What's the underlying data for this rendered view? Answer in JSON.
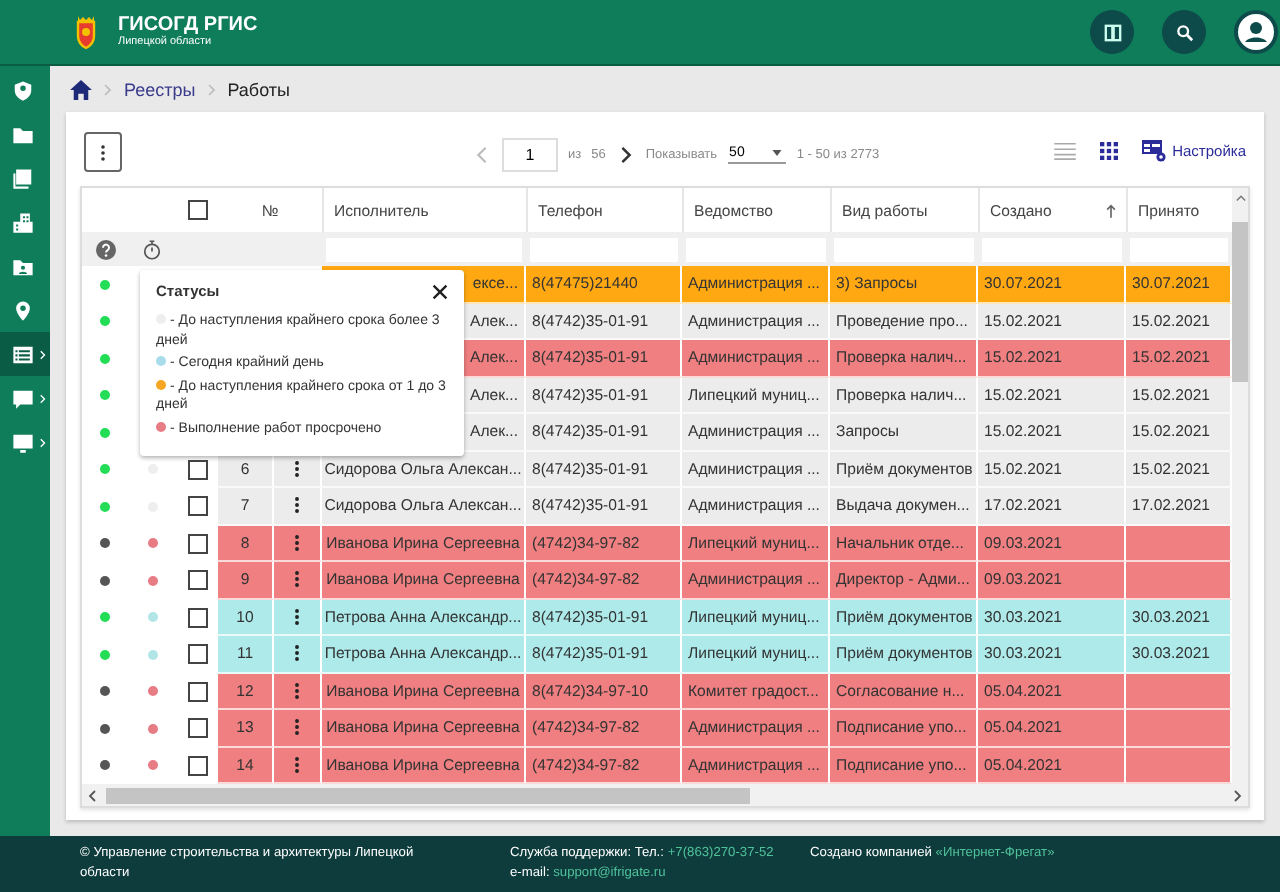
{
  "header": {
    "title": "ГИСОГД РГИС",
    "subtitle": "Липецкой области"
  },
  "sidebar": {
    "items": [
      {
        "kind": "account",
        "selected": false,
        "expandable": false
      },
      {
        "kind": "folder",
        "selected": false,
        "expandable": false
      },
      {
        "kind": "documents",
        "selected": false,
        "expandable": false
      },
      {
        "kind": "buildings",
        "selected": false,
        "expandable": false
      },
      {
        "kind": "folder-person",
        "selected": false,
        "expandable": false
      },
      {
        "kind": "pin",
        "selected": false,
        "expandable": false
      },
      {
        "kind": "list",
        "selected": true,
        "expandable": true
      },
      {
        "kind": "help-chat",
        "selected": false,
        "expandable": true
      },
      {
        "kind": "monitor",
        "selected": false,
        "expandable": true
      }
    ]
  },
  "breadcrumbs": [
    "Реестры",
    "Работы"
  ],
  "toolbar": {
    "page": "1",
    "of_label": "из",
    "page_count": "56",
    "show_label": "Показывать",
    "page_size": "50",
    "range": "1 - 50 из 2773",
    "settings_label": "Настройка"
  },
  "table": {
    "select_all": {
      "checked": false
    },
    "columns": [
      "№",
      "Исполнитель",
      "Телефон",
      "Ведомство",
      "Вид работы",
      "Создано",
      "Принято"
    ],
    "rows": [
      {
        "status": {
          "color": "#22dd55"
        },
        "color": "#ffa812",
        "executor": "ексе...",
        "phone": "8(47475)21440",
        "department": "Администрация ...",
        "work_type": "3) Запросы",
        "created": "30.07.2021",
        "accepted": "30.07.2021"
      },
      {
        "status": {
          "color": "#22dd55"
        },
        "color": "#ececec",
        "executor": "Алек...",
        "phone": "8(4742)35-01-91",
        "department": "Администрация ...",
        "work_type": "Проведение про...",
        "created": "15.02.2021",
        "accepted": "15.02.2021"
      },
      {
        "status": {
          "color": "#22dd55"
        },
        "color": "#ef7f80",
        "executor": "Алек...",
        "phone": "8(4742)35-01-91",
        "department": "Администрация ...",
        "work_type": "Проверка налич...",
        "created": "15.02.2021",
        "accepted": "15.02.2021"
      },
      {
        "status": {
          "color": "#22dd55"
        },
        "color": "#ececec",
        "executor": "Алек...",
        "phone": "8(4742)35-01-91",
        "department": "Липецкий муниц...",
        "work_type": "Проверка налич...",
        "created": "15.02.2021",
        "accepted": "15.02.2021"
      },
      {
        "status": {
          "color": "#22dd55"
        },
        "color": "#ececec",
        "executor": "Алек...",
        "phone": "8(4742)35-01-91",
        "department": "Администрация ...",
        "work_type": "Запросы",
        "created": "15.02.2021",
        "accepted": "15.02.2021"
      },
      {
        "status": {
          "color": "#22dd55"
        },
        "deadline": {
          "color": "#eeeeee"
        },
        "checked": false,
        "no": "6",
        "color": "#ececec",
        "executor": "Сидорова Ольга Алексан...",
        "phone": "8(4742)35-01-91",
        "department": "Администрация ...",
        "work_type": "Приём документов",
        "created": "15.02.2021",
        "accepted": "15.02.2021"
      },
      {
        "status": {
          "color": "#22dd55"
        },
        "deadline": {
          "color": "#eeeeee"
        },
        "checked": false,
        "no": "7",
        "color": "#ececec",
        "executor": "Сидорова Ольга Алексан...",
        "phone": "8(4742)35-01-91",
        "department": "Администрация ...",
        "work_type": "Выдача докумен...",
        "created": "17.02.2021",
        "accepted": "17.02.2021"
      },
      {
        "status": {
          "color": "#555555"
        },
        "deadline": {
          "color": "#e87c84"
        },
        "checked": false,
        "no": "8",
        "color": "#ef7f80",
        "executor": "Иванова Ирина Сергеевна",
        "phone": "(4742)34-97-82",
        "department": "Липецкий муниц...",
        "work_type": "Начальник отде...",
        "created": "09.03.2021"
      },
      {
        "status": {
          "color": "#555555"
        },
        "deadline": {
          "color": "#e87c84"
        },
        "checked": false,
        "no": "9",
        "color": "#ef7f80",
        "executor": "Иванова Ирина Сергеевна",
        "phone": "(4742)34-97-82",
        "department": "Администрация ...",
        "work_type": "Директор - Адми...",
        "created": "09.03.2021"
      },
      {
        "status": {
          "color": "#22dd55"
        },
        "deadline": {
          "color": "#b2e6e6"
        },
        "checked": false,
        "no": "10",
        "color": "#aeeaea",
        "executor": "Петрова Анна Александр...",
        "phone": "8(4742)35-01-91",
        "department": "Липецкий муниц...",
        "work_type": "Приём документов",
        "created": "30.03.2021",
        "accepted": "30.03.2021"
      },
      {
        "status": {
          "color": "#22dd55"
        },
        "deadline": {
          "color": "#b2e6e6"
        },
        "checked": false,
        "no": "11",
        "color": "#aeeaea",
        "executor": "Петрова Анна Александр...",
        "phone": "8(4742)35-01-91",
        "department": "Липецкий муниц...",
        "work_type": "Приём документов",
        "created": "30.03.2021",
        "accepted": "30.03.2021"
      },
      {
        "status": {
          "color": "#555555"
        },
        "deadline": {
          "color": "#e87c84"
        },
        "checked": false,
        "no": "12",
        "color": "#ef7f80",
        "executor": "Иванова Ирина Сергеевна",
        "phone": "8(4742)34-97-10",
        "department": "Комитет градост...",
        "work_type": "Согласование н...",
        "created": "05.04.2021"
      },
      {
        "status": {
          "color": "#555555"
        },
        "deadline": {
          "color": "#e87c84"
        },
        "checked": false,
        "no": "13",
        "color": "#ef7f80",
        "executor": "Иванова Ирина Сергеевна",
        "phone": "(4742)34-97-82",
        "department": "Администрация ...",
        "work_type": "Подписание упо...",
        "created": "05.04.2021"
      },
      {
        "status": {
          "color": "#555555"
        },
        "deadline": {
          "color": "#e87c84"
        },
        "checked": false,
        "no": "14",
        "color": "#ef7f80",
        "executor": "Иванова Ирина Сергеевна",
        "phone": "(4742)34-97-82",
        "department": "Администрация ...",
        "work_type": "Подписание упо...",
        "created": "05.04.2021"
      }
    ]
  },
  "legend": {
    "title": "Статусы",
    "items": [
      {
        "color": "#eeeeee",
        "text": "- До наступления крайнего срока более 3 дней"
      },
      {
        "color": "#a8dcea",
        "text": "- Сегодня крайний день"
      },
      {
        "color": "#f5a623",
        "text": "- До наступления крайнего срока от 1 до 3 дней"
      },
      {
        "color": "#e87c84",
        "text": "- Выполнение работ просрочено"
      }
    ]
  },
  "footer": {
    "copyright": "© Управление строительства и архитектуры Липецкой области",
    "support_label": "Служба поддержки: Тел.:",
    "phone": "+7(863)270-37-52",
    "email_label": "e-mail:",
    "email": "support@ifrigate.ru",
    "credit_label": "Создано компанией",
    "credit_link": "«Интернет-Фрегат»"
  }
}
